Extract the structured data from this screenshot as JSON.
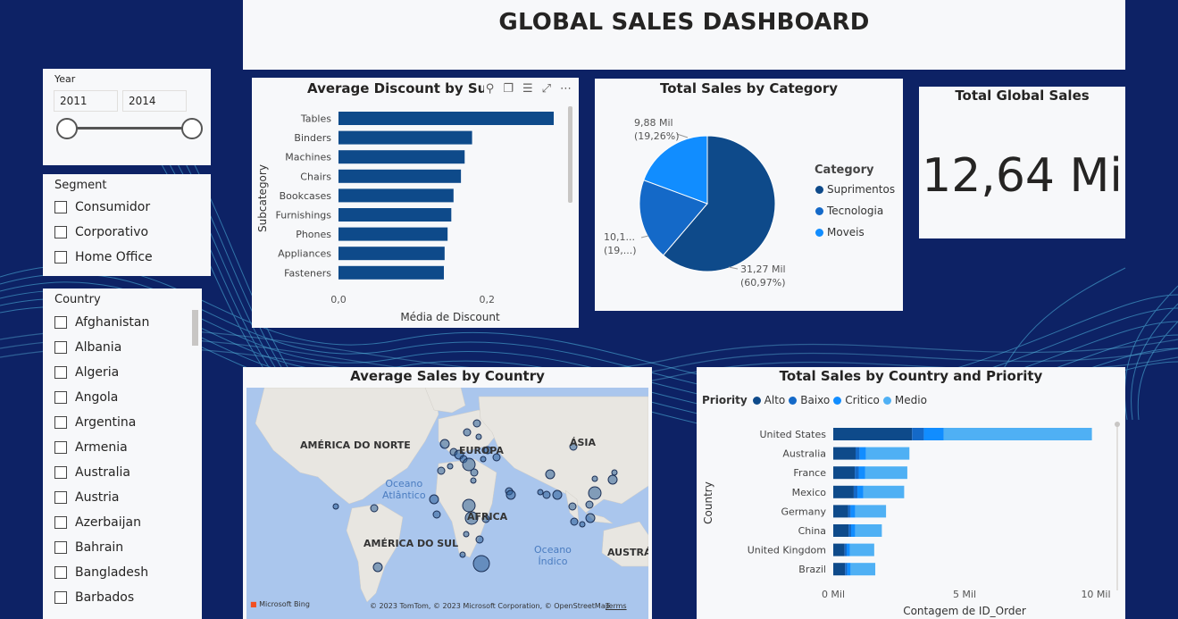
{
  "dashboard": {
    "title": "GLOBAL SALES DASHBOARD",
    "colors": {
      "background": "#0d2265",
      "card": "#f7f8fa",
      "dark_blue": "#0e4a8a",
      "mid_blue": "#1a78d6",
      "light_blue": "#4fb0f4",
      "accent_blue": "#118dff"
    }
  },
  "year_slicer": {
    "label": "Year",
    "start": "2011",
    "end": "2014"
  },
  "segment_slicer": {
    "label": "Segment",
    "items": [
      "Consumidor",
      "Corporativo",
      "Home Office"
    ]
  },
  "country_slicer": {
    "label": "Country",
    "items": [
      "Afghanistan",
      "Albania",
      "Algeria",
      "Angola",
      "Argentina",
      "Armenia",
      "Australia",
      "Austria",
      "Azerbaijan",
      "Bahrain",
      "Bangladesh",
      "Barbados"
    ]
  },
  "discount_chart": {
    "title": "Average Discount by Subcategory",
    "toolbar_icons": [
      "pin-icon",
      "copy-icon",
      "filter-icon",
      "focus-mode-icon",
      "more-options-icon"
    ],
    "chart_data": {
      "type": "bar",
      "orientation": "horizontal",
      "categories": [
        "Tables",
        "Binders",
        "Machines",
        "Chairs",
        "Bookcases",
        "Furnishings",
        "Phones",
        "Appliances",
        "Fasteners"
      ],
      "values": [
        0.29,
        0.18,
        0.17,
        0.165,
        0.155,
        0.152,
        0.147,
        0.143,
        0.142
      ],
      "xlabel": "Média de Discount",
      "ylabel": "Subcategory",
      "xticks": [
        "0,0",
        "0,2"
      ],
      "xlim": [
        0,
        0.29
      ],
      "color": "#0e4a8a"
    }
  },
  "category_chart": {
    "title": "Total Sales by Category",
    "chart_data": {
      "type": "pie",
      "legend_title": "Category",
      "labels": [
        "Suprimentos",
        "Tecnologia",
        "Moveis"
      ],
      "values": [
        31.27,
        9.9,
        9.88
      ],
      "percents": [
        "60,97%",
        "19,...",
        "19,26%"
      ],
      "data_labels": [
        {
          "value": "31,27 Mil",
          "percent": "(60,97%)"
        },
        {
          "value": "10,1...",
          "percent": "(19,...)"
        },
        {
          "value": "9,88 Mil",
          "percent": "(19,26%)"
        }
      ],
      "colors": [
        "#0e4a8a",
        "#1469c8",
        "#118dff"
      ]
    }
  },
  "kpi": {
    "title": "Total Global Sales",
    "value": "12,64 Mi"
  },
  "map_chart": {
    "title": "Average Sales by Country",
    "continents": [
      "AMÉRICA DO NORTE",
      "EUROPA",
      "ÁSIA",
      "ÁFRICA",
      "AMÉRICA DO SUL",
      "AUSTRÁL"
    ],
    "oceans": [
      [
        "Oceano",
        "Atlântico"
      ],
      [
        "Oceano",
        "Índico"
      ]
    ],
    "attribution": "© 2023 TomTom, © 2023 Microsoft Corporation, © OpenStreetMap",
    "terms": "Terms",
    "bing": "Microsoft Bing"
  },
  "priority_chart": {
    "title": "Total Sales by Country and Priority",
    "chart_data": {
      "type": "bar",
      "orientation": "horizontal",
      "stacked": true,
      "legend_title": "Priority",
      "categories": [
        "United States",
        "Australia",
        "France",
        "Mexico",
        "Germany",
        "China",
        "United Kingdom",
        "Brazil"
      ],
      "series": [
        {
          "name": "Alto",
          "values": [
            3000,
            850,
            820,
            780,
            560,
            580,
            430,
            450
          ]
        },
        {
          "name": "Baixo",
          "values": [
            450,
            150,
            150,
            140,
            100,
            100,
            80,
            80
          ]
        },
        {
          "name": "Critico",
          "values": [
            750,
            250,
            250,
            230,
            180,
            160,
            130,
            130
          ]
        },
        {
          "name": "Medio",
          "values": [
            5650,
            1650,
            1600,
            1550,
            1170,
            1010,
            920,
            940
          ]
        }
      ],
      "colors": [
        "#0e4a8a",
        "#1469c8",
        "#118dff",
        "#4fb0f4"
      ],
      "xlabel": "Contagem de ID_Order",
      "ylabel": "Country",
      "xticks": [
        "0 Mil",
        "5 Mil",
        "10 Mil"
      ],
      "xlim": [
        0,
        10000
      ]
    }
  }
}
